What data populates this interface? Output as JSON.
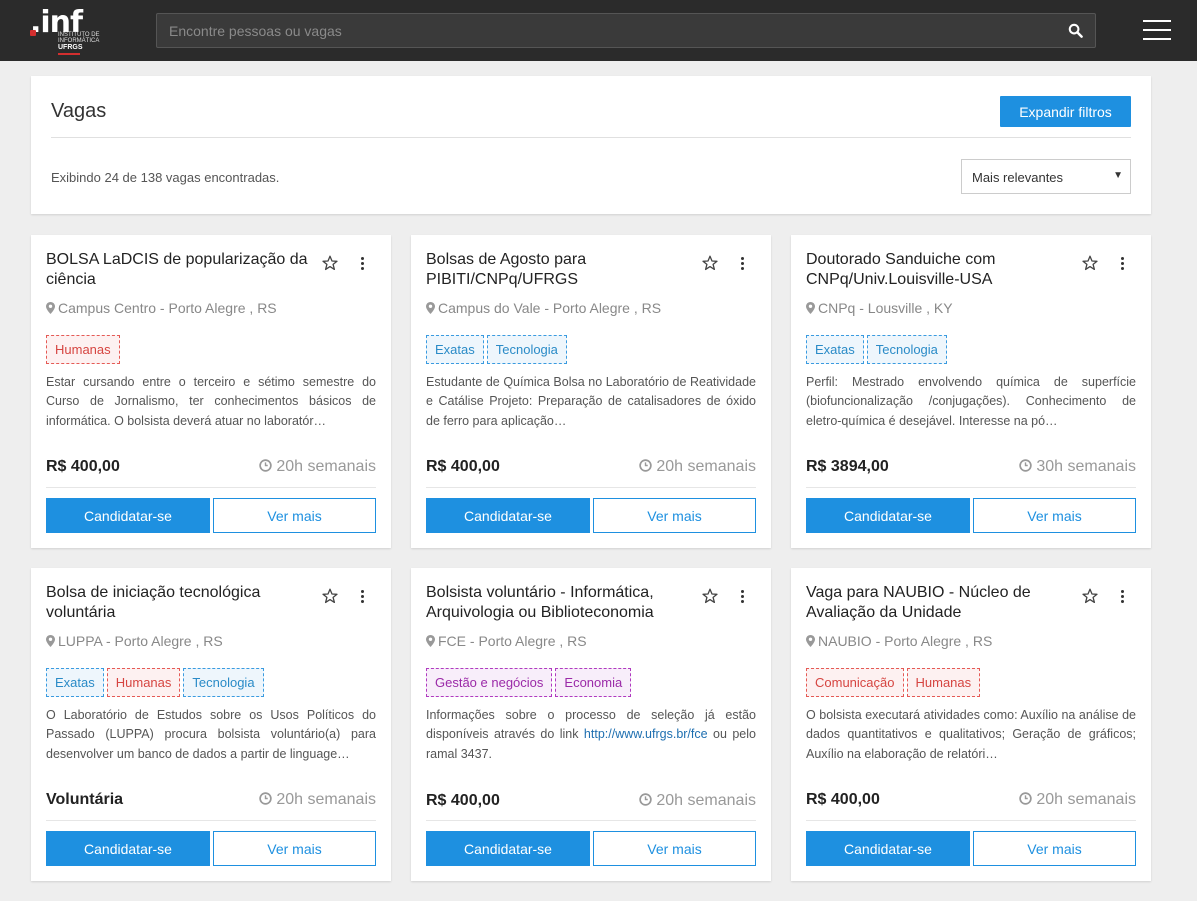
{
  "header": {
    "logo": {
      "name": ".inf",
      "sub": "INSTITUTO DE INFORMÁTICA",
      "org": "UFRGS"
    },
    "search": {
      "placeholder": "Encontre pessoas ou vagas",
      "value": "",
      "icon": "search-icon"
    },
    "menu_icon": "hamburger-menu-icon"
  },
  "jobs_panel": {
    "title": "Vagas",
    "expand_filters_label": "Expandir filtros",
    "result_count": "Exibindo 24 de 138 vagas encontradas.",
    "sort": {
      "selected": "Mais relevantes"
    }
  },
  "card_actions": {
    "apply_label": "Candidatar-se",
    "more_label": "Ver mais"
  },
  "cards": [
    {
      "title": "BOLSA LaDCIS de popularização da ciência",
      "location": "Campus Centro - Porto Alegre , RS",
      "tags": [
        {
          "label": "Humanas",
          "color": "red"
        }
      ],
      "description": "Estar cursando entre o terceiro e sétimo semestre do Curso de Jornalismo, ter conhecimentos básicos de informática. O bolsista deverá atuar no laboratór…",
      "price": "R$ 400,00",
      "hours": "20h semanais"
    },
    {
      "title": "Bolsas de Agosto para PIBITI/CNPq/UFRGS",
      "location": "Campus do Vale - Porto Alegre , RS",
      "tags": [
        {
          "label": "Exatas",
          "color": "blue"
        },
        {
          "label": "Tecnologia",
          "color": "blue"
        }
      ],
      "description": "Estudante de Química Bolsa no Laboratório de Reatividade e Catálise Projeto: Preparação de catalisadores de óxido de ferro para aplicação…",
      "price": "R$ 400,00",
      "hours": "20h semanais"
    },
    {
      "title": "Doutorado Sanduiche com CNPq/Univ.Louisville-USA",
      "location": "CNPq - Lousville , KY",
      "tags": [
        {
          "label": "Exatas",
          "color": "blue"
        },
        {
          "label": "Tecnologia",
          "color": "blue"
        }
      ],
      "description": "Perfil: Mestrado envolvendo química de superfície (biofuncionalização /conjugações). Conhecimento de eletro-química é desejável. Interesse na pó…",
      "price": "R$ 3894,00",
      "hours": "30h semanais"
    },
    {
      "title": "Bolsa de iniciação tecnológica voluntária",
      "location": "LUPPA - Porto Alegre , RS",
      "tags": [
        {
          "label": "Exatas",
          "color": "blue"
        },
        {
          "label": "Humanas",
          "color": "red"
        },
        {
          "label": "Tecnologia",
          "color": "blue"
        }
      ],
      "description": "O Laboratório de Estudos sobre os Usos Políticos do Passado (LUPPA) procura bolsista voluntário(a) para desenvolver um banco de dados a partir de linguage…",
      "price": "Voluntária",
      "hours": "20h semanais"
    },
    {
      "title": "Bolsista voluntário - Informática, Arquivologia ou Biblioteconomia",
      "location": "FCE - Porto Alegre , RS",
      "tags": [
        {
          "label": "Gestão e negócios",
          "color": "purple"
        },
        {
          "label": "Economia",
          "color": "purple"
        }
      ],
      "description_pre": "Informações sobre o processo de seleção já estão disponíveis através do link ",
      "description_link": "http://www.ufrgs.br/fce",
      "description_post": " ou pelo ramal 3437.",
      "price": "R$ 400,00",
      "hours": "20h semanais"
    },
    {
      "title": "Vaga para NAUBIO - Núcleo de Avaliação da Unidade",
      "location": "NAUBIO - Porto Alegre , RS",
      "tags": [
        {
          "label": "Comunicação",
          "color": "red"
        },
        {
          "label": "Humanas",
          "color": "red"
        }
      ],
      "description": "O bolsista executará atividades como: Auxílio na análise de dados quantitativos e qualitativos; Geração de gráficos; Auxílio na elaboração de relatóri…",
      "price": "R$ 400,00",
      "hours": "20h semanais"
    }
  ]
}
